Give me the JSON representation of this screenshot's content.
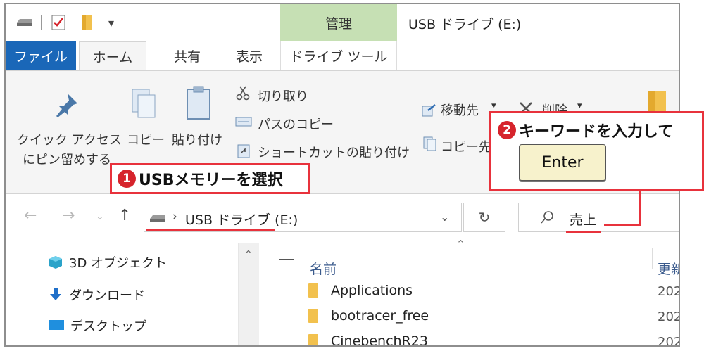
{
  "titlebar": {
    "manage_tab": "管理",
    "window_title": "USB ドライブ (E:)",
    "qa_dropdown": "▾"
  },
  "tabs": {
    "file": "ファイル",
    "home": "ホーム",
    "share": "共有",
    "view": "表示",
    "drive_tools": "ドライブ ツール"
  },
  "ribbon": {
    "pin_line1": "クイック アクセス",
    "pin_line2": "にピン留めする",
    "copy": "コピー",
    "paste": "貼り付け",
    "cut": "切り取り",
    "copy_path": "パスのコピー",
    "paste_shortcut": "ショートカットの貼り付け",
    "move_to": "移動先",
    "delete": "削除",
    "copy_to": "コピー先",
    "dropdown_arrow": "▾"
  },
  "nav": {
    "address": "USB ドライブ (E:)",
    "search_value": "売上"
  },
  "tree": {
    "items": [
      "3D オブジェクト",
      "ダウンロード",
      "デスクトップ"
    ]
  },
  "files": {
    "col_name": "名前",
    "col_date": "更新",
    "rows": [
      {
        "name": "Applications",
        "date": "202"
      },
      {
        "name": "bootracer_free",
        "date": "202"
      },
      {
        "name": "CinebenchR23",
        "date": "202"
      }
    ]
  },
  "annotations": {
    "step1_num": "1",
    "step1": "USBメモリーを選択",
    "step2_num": "2",
    "step2": "キーワードを入力して",
    "enter_key": "Enter"
  },
  "colors": {
    "accent": "#1a67b8",
    "manage": "#c6e0b4",
    "callout": "#e8323c",
    "folder": "#f2c14e"
  }
}
